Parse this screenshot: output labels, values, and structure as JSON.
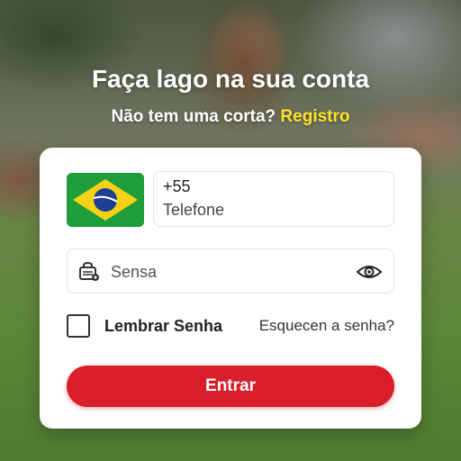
{
  "header": {
    "title": "Faça lago na sua conta",
    "no_account_text": "Não tem uma corta?",
    "register_link": "Registro"
  },
  "form": {
    "phone": {
      "country_flag": "brazil-flag",
      "dial_code": "+55",
      "placeholder": "Telefone"
    },
    "password": {
      "placeholder": "Sensa",
      "leading_icon": "lock-icon",
      "toggle_icon": "eye-icon"
    },
    "remember_label": "Lembrar Senha",
    "remember_checked": false,
    "forgot_link": "Esquecen a senha?",
    "submit_label": "Entrar"
  },
  "colors": {
    "accent_red": "#d81f2a",
    "link_yellow": "#ffe32b",
    "card_bg": "#ffffff"
  }
}
